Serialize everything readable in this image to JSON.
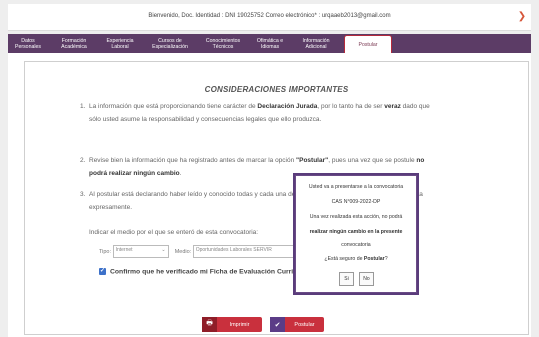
{
  "header": {
    "welcome": "Bienvenido, Doc. Identidad : DNI 19025752   Correo electrónico* : urqaaeb2013@gmail.com"
  },
  "tabs": [
    {
      "line1": "Datos",
      "line2": "Personales"
    },
    {
      "line1": "Formación",
      "line2": "Académica"
    },
    {
      "line1": "Experiencia",
      "line2": "Laboral"
    },
    {
      "line1": "Cursos de",
      "line2": "Especialización"
    },
    {
      "line1": "Conocimientos",
      "line2": "Técnicos"
    },
    {
      "line1": "Ofimática e",
      "line2": "Idiomas"
    },
    {
      "line1": "Información",
      "line2": "Adicional"
    },
    {
      "line1": "Postular",
      "line2": ""
    }
  ],
  "main": {
    "title": "CONSIDERACIONES IMPORTANTES",
    "items": [
      {
        "num": "1.",
        "pre": "La información que está proporcionando tiene carácter de ",
        "b1": "Declaración Jurada",
        "mid": ", por lo tanto ha de ser ",
        "b2": "veraz",
        "post": " dado que sólo usted asume la responsabilidad y consecuencias legales que ello produzca."
      },
      {
        "num": "2.",
        "pre": "Revise bien la información que ha registrado antes de marcar la opción ",
        "b1": "\"Postular\"",
        "mid": ", pues una vez que se postule ",
        "b2": "no podrá realizar ningún cambio",
        "post": "."
      },
      {
        "num": "3.",
        "pre": "Al postular está declarando haber leído y conocido todas y cada una ",
        "b1": "",
        "mid": "de las bases de esta convocatoria y las acepta expresamente.",
        "b2": "",
        "post": ""
      }
    ],
    "medio_label": "Indicar el medio por el que se enteró de esta convocatoria:",
    "tipo_label": "Tipo:",
    "tipo_value": "Internet",
    "medio_select_label": "Medio:",
    "medio_value": "Oportunidades Laborales SERVIR",
    "confirm_text": "Confirmo que he verificado mi Ficha de Evaluación Curricular",
    "imprimir": "Imprimir",
    "postular": "Postular"
  },
  "modal": {
    "line1": "Usted va a presentarse a la convocatoria",
    "line2": "CAS N°009-2022-DP",
    "line3": "Una vez realizada esta acción, no podrá",
    "line4": "realizar ningún cambio en la presente",
    "line5": "convocatoria",
    "line6_pre": "¿Está seguro de ",
    "line6_b": "Postular",
    "line6_post": "?",
    "yes": "Si",
    "no": "No"
  }
}
